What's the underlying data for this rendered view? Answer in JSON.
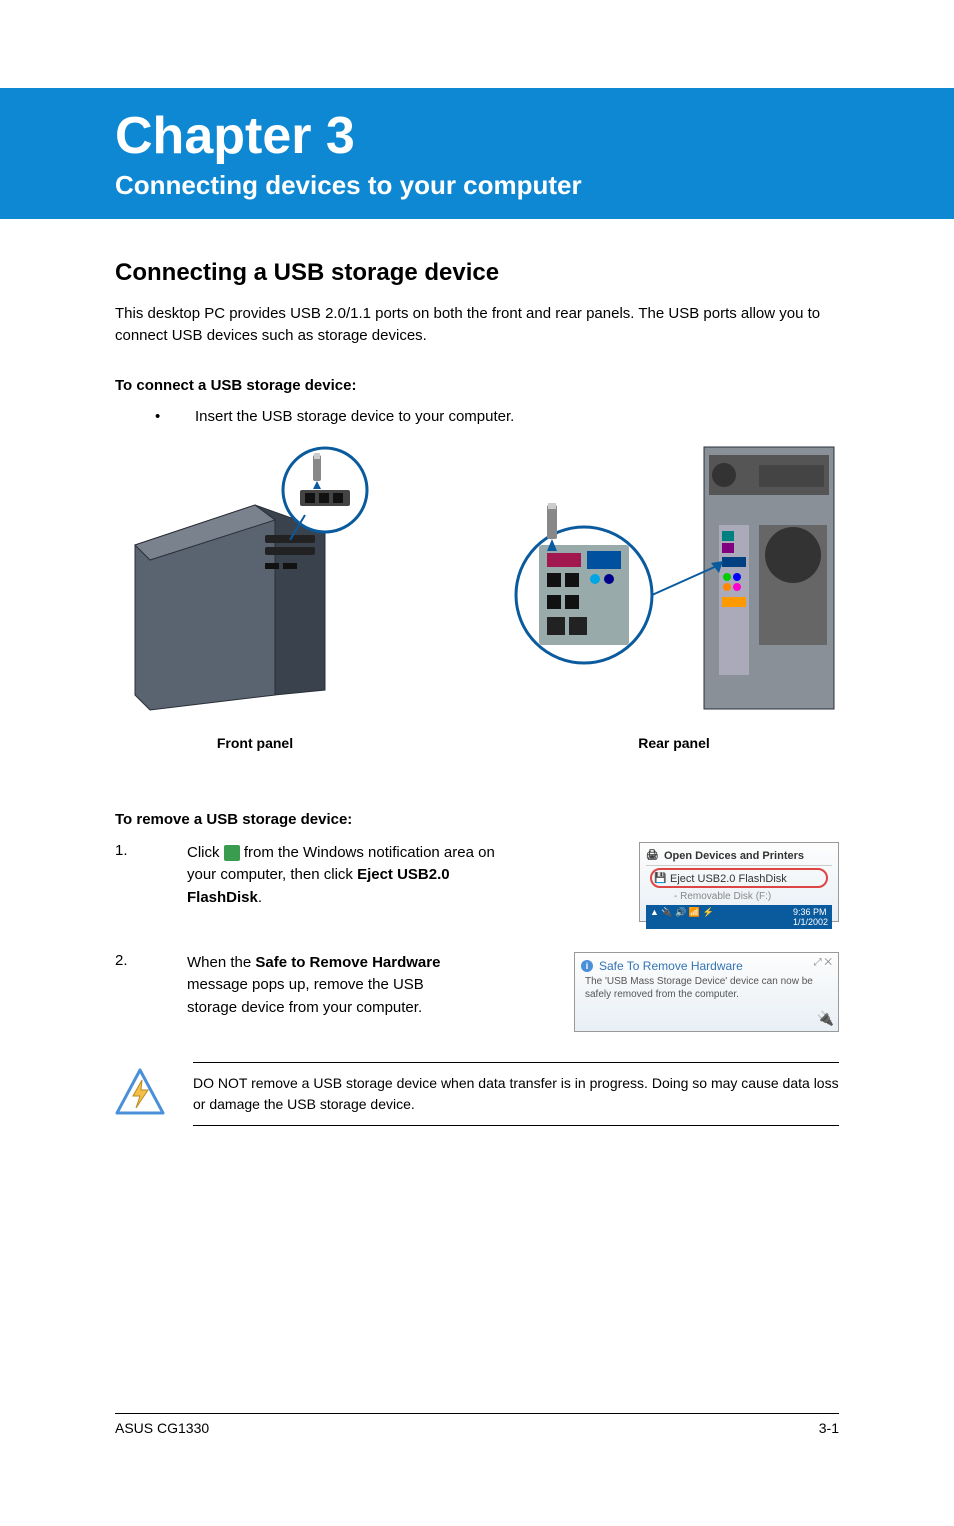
{
  "chapter": {
    "title": "Chapter 3",
    "subtitle": "Connecting devices to your computer"
  },
  "section": {
    "heading": "Connecting a USB storage device",
    "intro": "This desktop PC provides USB 2.0/1.1 ports on both the front and rear panels. The USB ports allow you to connect USB devices such as storage devices."
  },
  "connect": {
    "heading": "To connect a USB storage device:",
    "bullet": "Insert the USB storage device to your computer."
  },
  "panels": {
    "front_label": "Front panel",
    "rear_label": "Rear panel"
  },
  "remove": {
    "heading": "To remove a USB storage device:",
    "step1_num": "1.",
    "step1_pre": "Click ",
    "step1_mid": " from the Windows notification area on your computer, then click ",
    "step1_bold": "Eject USB2.0 FlashDisk",
    "step1_end": ".",
    "step2_num": "2.",
    "step2_pre": "When the ",
    "step2_bold": "Safe to Remove Hardware",
    "step2_end": " message pops up, remove the USB storage device from your computer."
  },
  "popup1": {
    "line1": "Open Devices and Printers",
    "line2": "Eject USB2.0 FlashDisk",
    "line3": "- Removable Disk (F:)",
    "tray_time": "9:36 PM",
    "tray_date": "1/1/2002"
  },
  "popup2": {
    "title": "Safe To Remove Hardware",
    "body": "The 'USB Mass Storage Device' device can now be safely removed from the computer."
  },
  "warning": {
    "text": "DO NOT remove a USB storage device when data transfer is in progress. Doing so may cause data loss or damage the USB storage device."
  },
  "footer": {
    "left": "ASUS CG1330",
    "right": "3-1"
  }
}
